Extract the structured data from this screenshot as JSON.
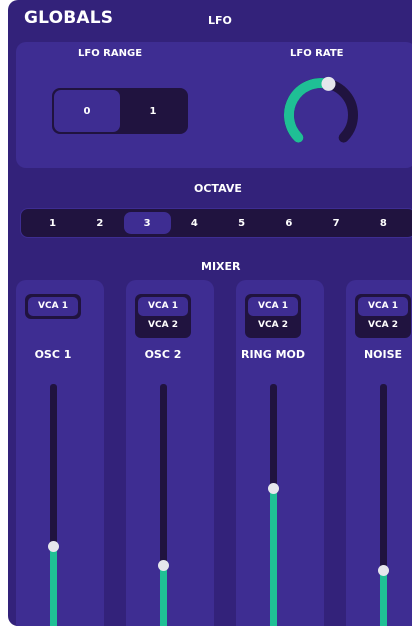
{
  "header": {
    "title": "GLOBALS",
    "tab": "LFO"
  },
  "lfo": {
    "range_label": "LFO RANGE",
    "range_options": [
      "0",
      "1"
    ],
    "range_selected": 0,
    "rate_label": "LFO RATE",
    "rate_value": 0.55
  },
  "octave": {
    "label": "OCTAVE",
    "options": [
      "1",
      "2",
      "3",
      "4",
      "5",
      "6",
      "7",
      "8"
    ],
    "selected": 2
  },
  "mixer": {
    "label": "MIXER",
    "channels": [
      {
        "name": "OSC 1",
        "vcas": [
          "VCA 1"
        ],
        "active_vca": 0,
        "level": 0.33
      },
      {
        "name": "OSC 2",
        "vcas": [
          "VCA 1",
          "VCA 2"
        ],
        "active_vca": 0,
        "level": 0.25
      },
      {
        "name": "RING MOD",
        "vcas": [
          "VCA 1",
          "VCA 2"
        ],
        "active_vca": 0,
        "level": 0.57
      },
      {
        "name": "NOISE",
        "vcas": [
          "VCA 1",
          "VCA 2"
        ],
        "active_vca": 0,
        "level": 0.23
      }
    ]
  },
  "colors": {
    "panel": "#33227a",
    "box": "#3e2d92",
    "dark": "#20133f",
    "accent": "#1fbf95",
    "knob_track": "#20133f",
    "thumb": "#e6e6ec"
  }
}
